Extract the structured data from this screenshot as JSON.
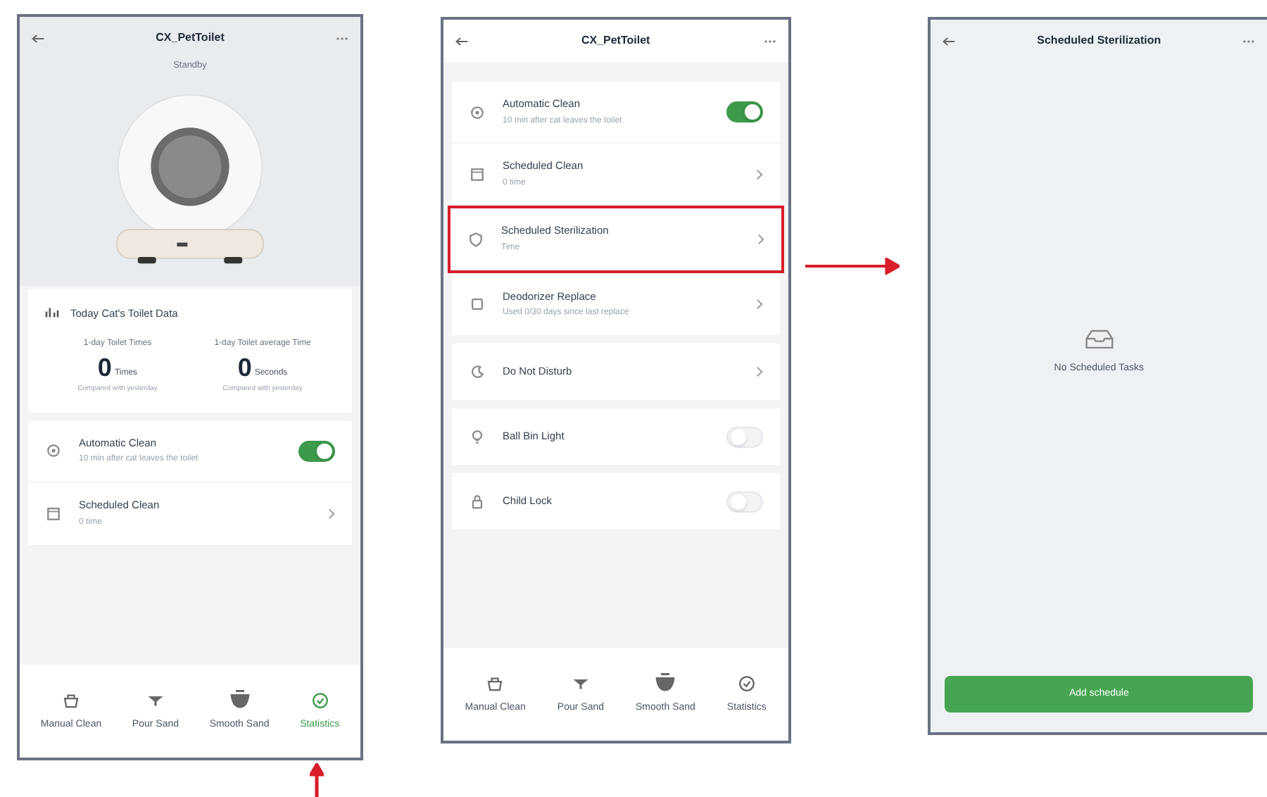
{
  "device_screen": {
    "title": "CX_PetToilet",
    "status": "Standby",
    "stats": {
      "heading": "Today Cat's Toilet Data",
      "items": [
        {
          "label": "1-day Toilet Times",
          "value": "0",
          "unit": "Times",
          "note": "Compared with yesterday"
        },
        {
          "label": "1-day Toilet average Time",
          "value": "0",
          "unit": "Seconds",
          "note": "Compared with yesterday"
        }
      ]
    },
    "settings": [
      {
        "kind": "toggle",
        "title": "Automatic Clean",
        "subtitle": "10 min after cat leaves the toilet",
        "on": true
      },
      {
        "kind": "link",
        "title": "Scheduled Clean",
        "subtitle": "0 time"
      }
    ],
    "nav": [
      {
        "label": "Manual Clean",
        "selected": false
      },
      {
        "label": "Pour Sand",
        "selected": false
      },
      {
        "label": "Smooth Sand",
        "selected": false
      },
      {
        "label": "Statistics",
        "selected": true
      }
    ]
  },
  "settings_screen": {
    "title": "CX_PetToilet",
    "groups": [
      [
        {
          "kind": "toggle",
          "title": "Automatic Clean",
          "subtitle": "10 min after cat leaves the toilet",
          "on": true,
          "highlighted": false
        },
        {
          "kind": "link",
          "title": "Scheduled Clean",
          "subtitle": "0 time",
          "highlighted": false
        },
        {
          "kind": "link",
          "title": "Scheduled Sterilization",
          "subtitle": "Time",
          "highlighted": true
        },
        {
          "kind": "link",
          "title": "Deodorizer Replace",
          "subtitle": "Used 0/30 days since last replace",
          "highlighted": false
        }
      ],
      [
        {
          "kind": "link",
          "title": "Do Not Disturb",
          "highlighted": false
        }
      ],
      [
        {
          "kind": "toggle",
          "title": "Ball Bin Light",
          "on": false,
          "highlighted": false
        }
      ],
      [
        {
          "kind": "toggle",
          "title": "Child Lock",
          "on": false,
          "highlighted": false
        }
      ]
    ],
    "nav": [
      {
        "label": "Manual Clean",
        "selected": false
      },
      {
        "label": "Pour Sand",
        "selected": false
      },
      {
        "label": "Smooth Sand",
        "selected": false
      },
      {
        "label": "Statistics",
        "selected": false
      }
    ]
  },
  "sterilization_screen": {
    "title": "Scheduled Sterilization",
    "empty_message": "No Scheduled Tasks",
    "button": "Add schedule"
  }
}
